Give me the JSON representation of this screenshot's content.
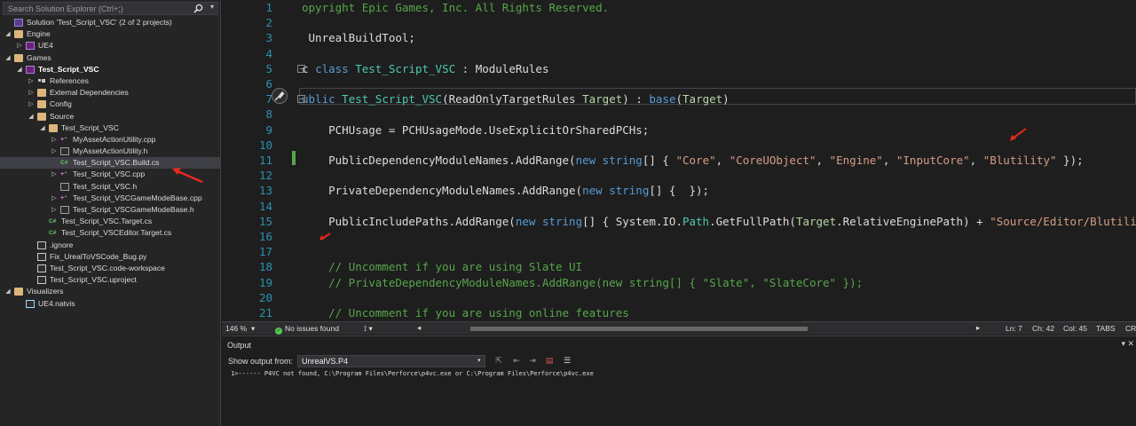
{
  "solution_explorer": {
    "search_placeholder": "Search Solution Explorer (Ctrl+;)",
    "tree": [
      {
        "label": "Solution 'Test_Script_VSC' (2 of 2 projects)",
        "icon": "solution-icon",
        "depth": 0,
        "expander": ""
      },
      {
        "label": "Engine",
        "icon": "folder-icon",
        "depth": 0,
        "expander": "open"
      },
      {
        "label": "UE4",
        "icon": "project-icon",
        "depth": 1,
        "expander": "closed"
      },
      {
        "label": "Games",
        "icon": "folder-icon",
        "depth": 0,
        "expander": "open"
      },
      {
        "label": "Test_Script_VSC",
        "icon": "project-icon",
        "depth": 1,
        "expander": "open",
        "bold": true
      },
      {
        "label": "References",
        "icon": "references-icon",
        "depth": 2,
        "expander": "closed"
      },
      {
        "label": "External Dependencies",
        "icon": "folder-icon",
        "depth": 2,
        "expander": "closed"
      },
      {
        "label": "Config",
        "icon": "folder-icon",
        "depth": 2,
        "expander": "closed"
      },
      {
        "label": "Source",
        "icon": "folder-icon",
        "depth": 2,
        "expander": "open"
      },
      {
        "label": "Test_Script_VSC",
        "icon": "folder-icon",
        "depth": 3,
        "expander": "open"
      },
      {
        "label": "MyAssetActionUtility.cpp",
        "icon": "cpp-file-icon",
        "depth": 4,
        "expander": "closed"
      },
      {
        "label": "MyAssetActionUtility.h",
        "icon": "header-file-icon",
        "depth": 4,
        "expander": "closed"
      },
      {
        "label": "Test_Script_VSC.Build.cs",
        "icon": "csharp-file-icon",
        "depth": 4,
        "expander": "",
        "selected": true
      },
      {
        "label": "Test_Script_VSC.cpp",
        "icon": "cpp-file-icon",
        "depth": 4,
        "expander": "closed"
      },
      {
        "label": "Test_Script_VSC.h",
        "icon": "header-file-icon",
        "depth": 4,
        "expander": ""
      },
      {
        "label": "Test_Script_VSCGameModeBase.cpp",
        "icon": "cpp-file-icon",
        "depth": 4,
        "expander": "closed"
      },
      {
        "label": "Test_Script_VSCGameModeBase.h",
        "icon": "header-file-icon",
        "depth": 4,
        "expander": "closed"
      },
      {
        "label": "Test_Script_VSC.Target.cs",
        "icon": "csharp-file-icon",
        "depth": 3,
        "expander": ""
      },
      {
        "label": "Test_Script_VSCEditor.Target.cs",
        "icon": "csharp-file-icon",
        "depth": 3,
        "expander": ""
      },
      {
        "label": ".ignore",
        "icon": "file-icon",
        "depth": 2,
        "expander": ""
      },
      {
        "label": "Fix_UrealToVSCode_Bug.py",
        "icon": "file-icon",
        "depth": 2,
        "expander": ""
      },
      {
        "label": "Test_Script_VSC.code-workspace",
        "icon": "file-icon",
        "depth": 2,
        "expander": ""
      },
      {
        "label": "Test_Script_VSC.uproject",
        "icon": "file-icon",
        "depth": 2,
        "expander": ""
      },
      {
        "label": "Visualizers",
        "icon": "folder-icon",
        "depth": 0,
        "expander": "open"
      },
      {
        "label": "UE4.natvis",
        "icon": "natvis-file-icon",
        "depth": 1,
        "expander": ""
      }
    ]
  },
  "editor": {
    "line_numbers": [
      "1",
      "2",
      "3",
      "4",
      "5",
      "6",
      "7",
      "8",
      "9",
      "10",
      "11",
      "12",
      "13",
      "14",
      "15",
      "16",
      "17",
      "18",
      "19",
      "20",
      "21"
    ],
    "lines": [
      [
        {
          "t": "opyright Epic Games, Inc. All Rights Reserved.",
          "c": "cm"
        }
      ],
      [],
      [
        {
          "t": " UnrealBuildTool;",
          "c": ""
        }
      ],
      [],
      [
        {
          "t": "c ",
          "c": ""
        },
        {
          "t": "class",
          "c": "kw"
        },
        {
          "t": " ",
          "c": ""
        },
        {
          "t": "Test_Script_VSC",
          "c": "ty"
        },
        {
          "t": " : ModuleRules",
          "c": ""
        }
      ],
      [],
      [
        {
          "t": "ublic",
          "c": "kw"
        },
        {
          "t": " ",
          "c": ""
        },
        {
          "t": "Test_Script_VSC",
          "c": "ty"
        },
        {
          "t": "(ReadOnlyTargetRules ",
          "c": ""
        },
        {
          "t": "Target",
          "c": "pr"
        },
        {
          "t": ") : ",
          "c": ""
        },
        {
          "t": "base",
          "c": "kw"
        },
        {
          "t": "(",
          "c": ""
        },
        {
          "t": "Target",
          "c": "pr"
        },
        {
          "t": ")",
          "c": ""
        }
      ],
      [],
      [
        {
          "t": "    PCHUsage = PCHUsageMode.UseExplicitOrSharedPCHs;",
          "c": ""
        }
      ],
      [],
      [
        {
          "t": "    PublicDependencyModuleNames.AddRange(",
          "c": ""
        },
        {
          "t": "new",
          "c": "kw"
        },
        {
          "t": " ",
          "c": ""
        },
        {
          "t": "string",
          "c": "kw"
        },
        {
          "t": "[] { ",
          "c": ""
        },
        {
          "t": "\"Core\"",
          "c": "st"
        },
        {
          "t": ", ",
          "c": ""
        },
        {
          "t": "\"CoreUObject\"",
          "c": "st"
        },
        {
          "t": ", ",
          "c": ""
        },
        {
          "t": "\"Engine\"",
          "c": "st"
        },
        {
          "t": ", ",
          "c": ""
        },
        {
          "t": "\"InputCore\"",
          "c": "st"
        },
        {
          "t": ", ",
          "c": ""
        },
        {
          "t": "\"Blutility\"",
          "c": "st"
        },
        {
          "t": " });",
          "c": ""
        }
      ],
      [],
      [
        {
          "t": "    PrivateDependencyModuleNames.AddRange(",
          "c": ""
        },
        {
          "t": "new",
          "c": "kw"
        },
        {
          "t": " ",
          "c": ""
        },
        {
          "t": "string",
          "c": "kw"
        },
        {
          "t": "[] {  });",
          "c": ""
        }
      ],
      [],
      [
        {
          "t": "    PublicIncludePaths.AddRange(",
          "c": ""
        },
        {
          "t": "new",
          "c": "kw"
        },
        {
          "t": " ",
          "c": ""
        },
        {
          "t": "string",
          "c": "kw"
        },
        {
          "t": "[] { System.IO.",
          "c": ""
        },
        {
          "t": "Path",
          "c": "ty"
        },
        {
          "t": ".GetFullPath(",
          "c": ""
        },
        {
          "t": "Target",
          "c": "pr"
        },
        {
          "t": ".RelativeEnginePath) + ",
          "c": ""
        },
        {
          "t": "\"Source/Editor/Blutility/Pr",
          "c": "st"
        }
      ],
      [],
      [],
      [
        {
          "t": "    // Uncomment if you are using Slate UI",
          "c": "cm"
        }
      ],
      [
        {
          "t": "    // PrivateDependencyModuleNames.AddRange(new string[] { \"Slate\", \"SlateCore\" });",
          "c": "cm"
        }
      ],
      [],
      [
        {
          "t": "    // Uncomment if you are using online features",
          "c": "cm"
        }
      ]
    ]
  },
  "status": {
    "zoom": "146 %",
    "issues": "No issues found",
    "ln": "Ln: 7",
    "ch": "Ch: 42",
    "col": "Col: 45",
    "tabs": "TABS",
    "crlf": "CRL"
  },
  "output": {
    "title": "Output",
    "show_from_label": "Show output from:",
    "source": "UnrealVS.P4",
    "text": "1>------ P4VC not found, C:\\Program Files\\Perforce\\p4vc.exe or C:\\Program Files\\Perforce\\p4vc.exe"
  },
  "colors": {
    "keyword": "#569cd6",
    "type": "#4ec9b0",
    "string": "#d69d85",
    "comment": "#57a64a",
    "line_number": "#2b91af",
    "annotation_arrow": "#e8281f"
  }
}
